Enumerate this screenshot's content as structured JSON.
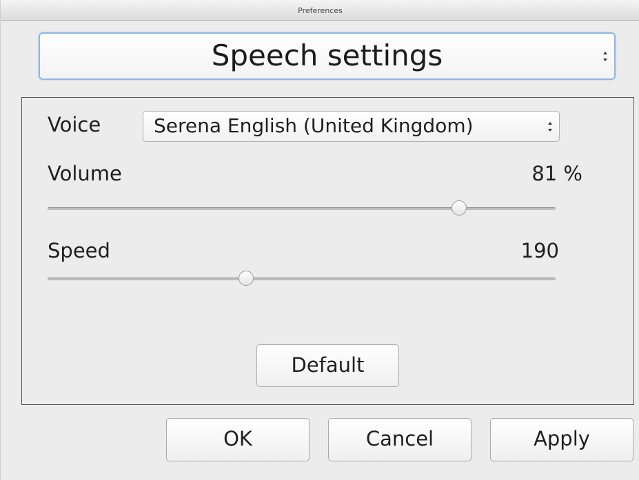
{
  "window": {
    "title": "Preferences"
  },
  "section_select": {
    "value": "Speech settings"
  },
  "voice": {
    "label": "Voice",
    "selected": "Serena English (United Kingdom)"
  },
  "volume": {
    "label": "Volume",
    "value_text": "81 %",
    "value": 81,
    "min": 0,
    "max": 100
  },
  "speed": {
    "label": "Speed",
    "value_text": "190",
    "value": 190
  },
  "buttons": {
    "default_label": "Default",
    "ok_label": "OK",
    "cancel_label": "Cancel",
    "apply_label": "Apply"
  }
}
